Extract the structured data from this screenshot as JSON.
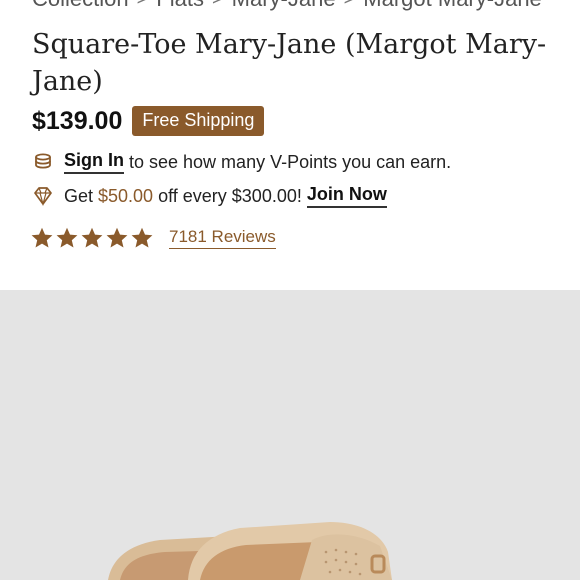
{
  "breadcrumb": {
    "items": [
      "Collection",
      "Flats",
      "Mary-Jane",
      "Margot Mary-Jane"
    ],
    "separator": ">"
  },
  "product": {
    "title": "Square-Toe Mary-Jane (Margot Mary-Jane)",
    "price": "$139.00",
    "shipping_badge": "Free Shipping"
  },
  "points": {
    "sign_in_link": "Sign In",
    "sign_in_text": " to see how many V-Points you can earn.",
    "offer_prefix": "Get ",
    "offer_amount": "$50.00",
    "offer_suffix": " off every $300.00! ",
    "join_link": "Join Now"
  },
  "rating": {
    "stars": 5,
    "reviews_label": "7181 Reviews"
  },
  "icons": {
    "coins": "coins-icon",
    "diamond": "diamond-icon",
    "star": "star-icon"
  },
  "colors": {
    "accent": "#8a5a2b",
    "gallery_bg": "#e4e4e4"
  }
}
